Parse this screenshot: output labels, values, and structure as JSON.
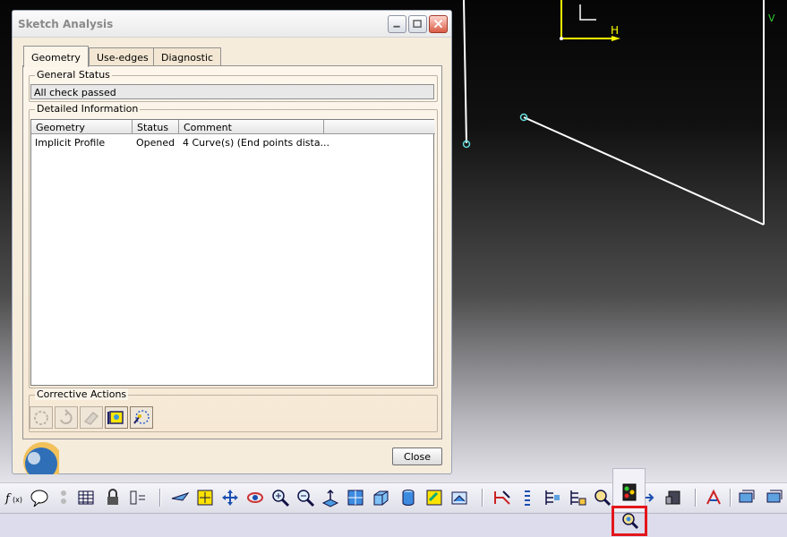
{
  "dialog": {
    "title": "Sketch Analysis",
    "tabs": [
      "Geometry",
      "Use-edges",
      "Diagnostic"
    ],
    "active_tab": "Geometry",
    "general_status": {
      "legend": "General Status",
      "value": "All check passed"
    },
    "detailed_info": {
      "legend": "Detailed Information",
      "columns": [
        "Geometry",
        "Status",
        "Comment"
      ],
      "rows": [
        {
          "geometry": "Implicit Profile",
          "status": "Opened",
          "comment": "4 Curve(s) (End points dista..."
        }
      ]
    },
    "corrective_actions": {
      "legend": "Corrective Actions",
      "buttons": [
        "close-profile-icon",
        "rotate-point-icon",
        "erase-icon",
        "hide-constructions-icon",
        "hide-constraints-icon"
      ]
    },
    "close_label": "Close"
  },
  "canvas": {
    "axis_labels": {
      "h": "H",
      "v": "V"
    },
    "colors": {
      "background": "#050505",
      "geometry": "#ffffff",
      "axis": "#ffff00",
      "point": "#66dddd"
    }
  },
  "toolbar": {
    "icons": [
      "formula-icon",
      "comment-icon",
      "dependency-icon",
      "table-icon",
      "lock-icon",
      "constraint-icon",
      "fly-icon",
      "fit-all-icon",
      "pan-icon",
      "rotate-view-icon",
      "zoom-in-icon",
      "zoom-out-icon",
      "normal-view-icon",
      "quick-view-icon",
      "view-mode-icon",
      "cylinder-icon",
      "apply-material-icon",
      "hide-show-icon",
      "sketch-solve-icon",
      "sketch-analysis-icon",
      "sketch-check-icon",
      "output-icon",
      "profile-icon",
      "publish-icon",
      "measure-icon",
      "window-icon",
      "print-icon"
    ],
    "highlighted": "sketch-analysis-icon"
  }
}
